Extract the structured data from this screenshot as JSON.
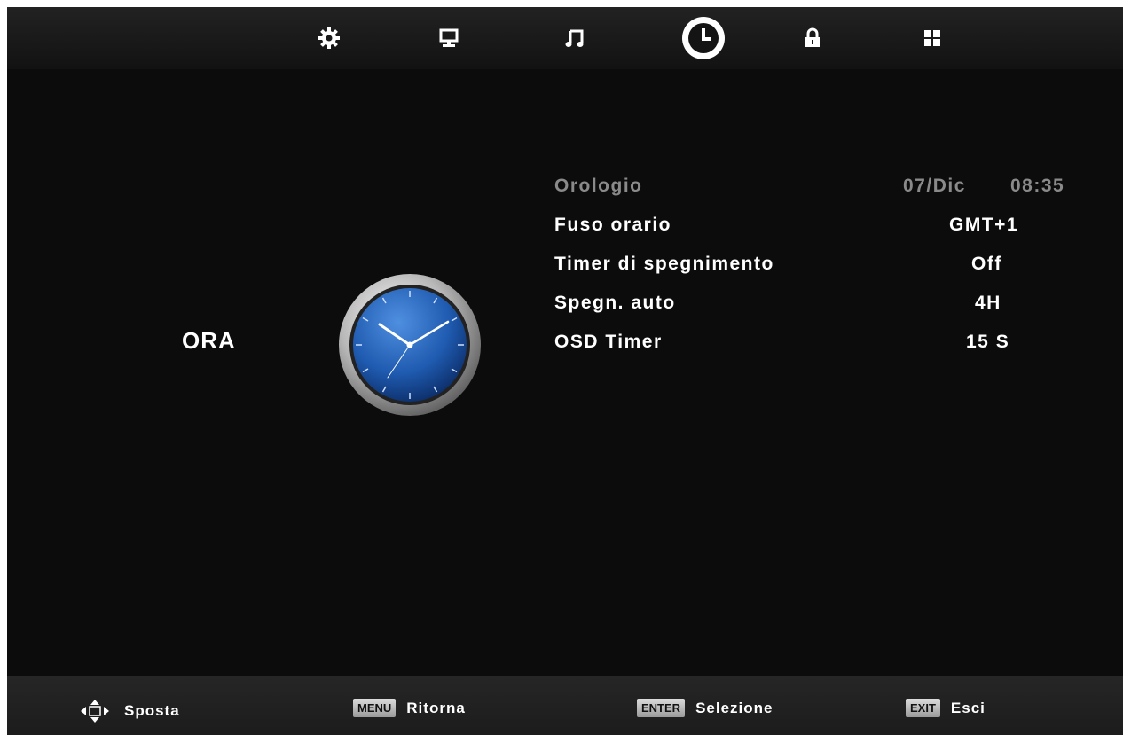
{
  "top_tabs": [
    {
      "name": "picture-settings",
      "icon": "gear-icon",
      "selected": false
    },
    {
      "name": "screen",
      "icon": "monitor-icon",
      "selected": false
    },
    {
      "name": "sound",
      "icon": "music-note-icon",
      "selected": false
    },
    {
      "name": "time",
      "icon": "clock-icon",
      "selected": true
    },
    {
      "name": "lock",
      "icon": "lock-icon",
      "selected": false
    },
    {
      "name": "options",
      "icon": "grid-icon",
      "selected": false
    }
  ],
  "section": {
    "title": "ORA",
    "icon": "analog-clock-icon"
  },
  "menu": {
    "items": [
      {
        "label": "Orologio",
        "date": "07/Dic",
        "time": "08:35",
        "enabled": false
      },
      {
        "label": "Fuso orario",
        "value": "GMT+1",
        "enabled": true
      },
      {
        "label": "Timer di spegnimento",
        "value": "Off",
        "enabled": true
      },
      {
        "label": "Spegn. auto",
        "value": "4H",
        "enabled": true
      },
      {
        "label": "OSD Timer",
        "value": "15 S",
        "enabled": true
      }
    ]
  },
  "footer": {
    "move": {
      "icon": "arrows-icon",
      "label": "Sposta"
    },
    "back": {
      "key": "MENU",
      "label": "Ritorna"
    },
    "select": {
      "key": "ENTER",
      "label": "Selezione"
    },
    "exit": {
      "key": "EXIT",
      "label": "Esci"
    }
  },
  "colors": {
    "background": "#0c0c0c",
    "text": "#ffffff",
    "disabled_text": "#8a8a8a",
    "clock_face": "#1f5bb0"
  }
}
